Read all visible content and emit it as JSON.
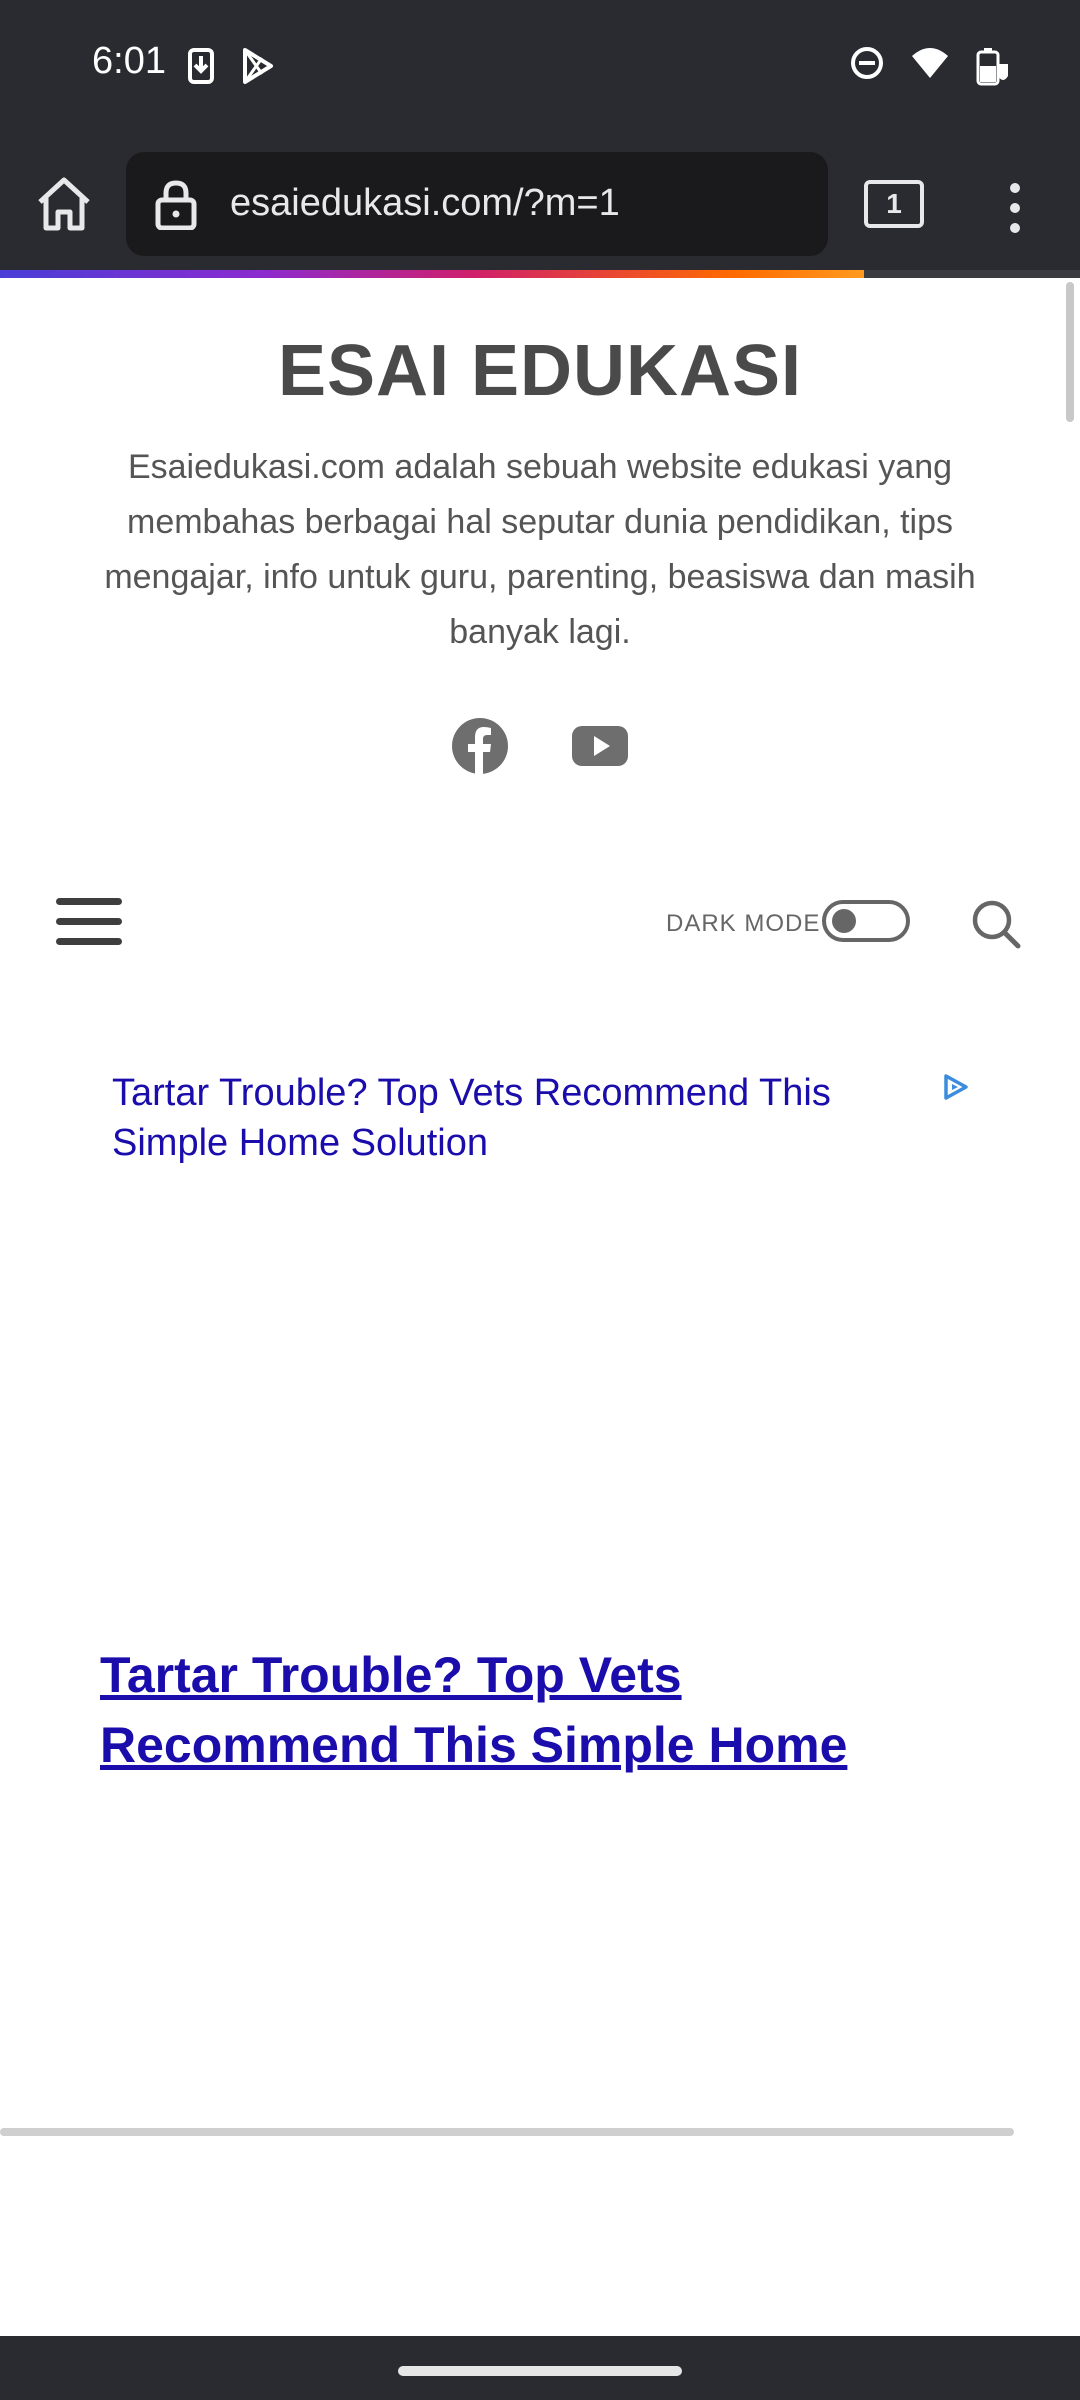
{
  "status_bar": {
    "time": "6:01",
    "left_icons": [
      "download-icon",
      "play-store-icon"
    ],
    "right_icons": [
      "do-not-disturb-icon",
      "wifi-icon",
      "battery-icon"
    ]
  },
  "browser": {
    "url": "esaiedukasi.com/?m=1",
    "tab_count": "1",
    "progress": 0.8
  },
  "site": {
    "title": "ESAI EDUKASI",
    "description": "Esaiedukasi.com adalah sebuah website edukasi yang membahas berbagai hal seputar dunia pendidikan, tips mengajar, info untuk guru, parenting, beasiswa dan masih banyak lagi.",
    "social": [
      "facebook-icon",
      "youtube-icon"
    ]
  },
  "navigation": {
    "dark_mode_label": "DARK MODE",
    "dark_mode_on": false
  },
  "ad": {
    "text": "Tartar Trouble? Top Vets Recommend This Simple Home Solution",
    "headline": "Tartar Trouble? Top Vets Recommend This Simple Home Solution"
  },
  "colors": {
    "chrome": "#2a2b30",
    "ad_link": "#1a0dab",
    "title": "#4a4a4a"
  }
}
